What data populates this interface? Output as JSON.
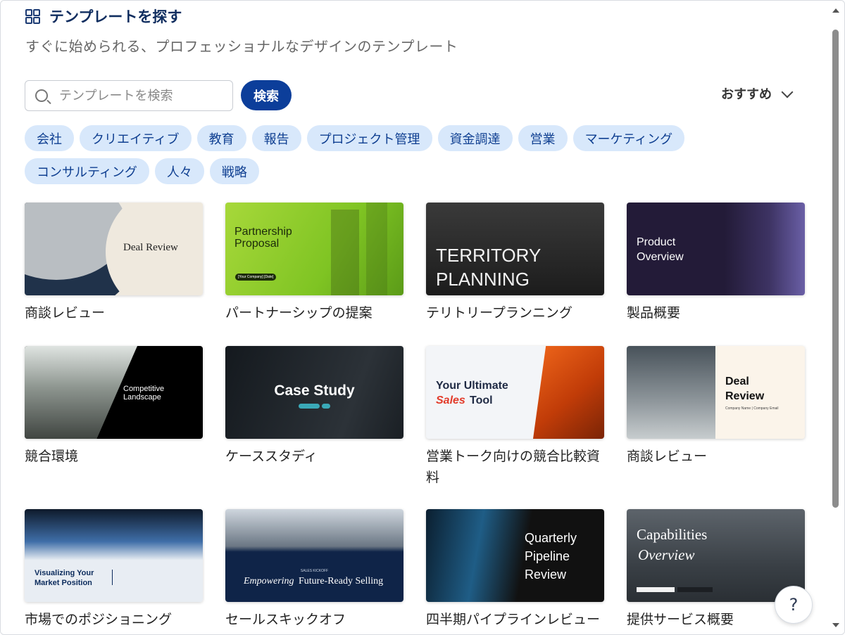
{
  "header": {
    "title": "テンプレートを探す",
    "subtitle": "すぐに始められる、プロフェッショナルなデザインのテンプレート"
  },
  "search": {
    "placeholder": "テンプレートを検索",
    "button": "検索"
  },
  "sort": {
    "label": "おすすめ"
  },
  "categories": [
    "会社",
    "クリエイティブ",
    "教育",
    "報告",
    "プロジェクト管理",
    "資金調達",
    "営業",
    "マーケティング",
    "コンサルティング",
    "人々",
    "戦略"
  ],
  "templates": [
    {
      "caption": "商談レビュー",
      "thumb_title": "Deal Review"
    },
    {
      "caption": "パートナーシップの提案",
      "thumb_title": "Partnership Proposal",
      "thumb_sub": "[Your Company]  [Date]"
    },
    {
      "caption": "テリトリープランニング",
      "thumb_title": "TERRITORY PLANNING"
    },
    {
      "caption": "製品概要",
      "thumb_title": "Product Overview"
    },
    {
      "caption": "競合環境",
      "thumb_title": "Competitive Landscape"
    },
    {
      "caption": "ケーススタディ",
      "thumb_title": "Case Study"
    },
    {
      "caption": "営業トーク向けの競合比較資料",
      "thumb_title_1": "Your Ultimate",
      "thumb_title_2": "Sales",
      "thumb_title_3": "Tool"
    },
    {
      "caption": "商談レビュー",
      "thumb_title": "Deal Review",
      "thumb_sub": "Company Name | Company Email"
    },
    {
      "caption": "市場でのポジショニング",
      "thumb_title": "Visualizing Your Market Position"
    },
    {
      "caption": "セールスキックオフ",
      "thumb_kicker": "SALES KICKOFF",
      "thumb_title_1": "Empowering",
      "thumb_title_2": "Future-Ready Selling"
    },
    {
      "caption": "四半期パイプラインレビュー",
      "thumb_title": "Quarterly Pipeline Review"
    },
    {
      "caption": "提供サービス概要",
      "thumb_title_1": "Capabilities",
      "thumb_title_2": "Overview"
    }
  ],
  "help": {
    "label": "?"
  }
}
